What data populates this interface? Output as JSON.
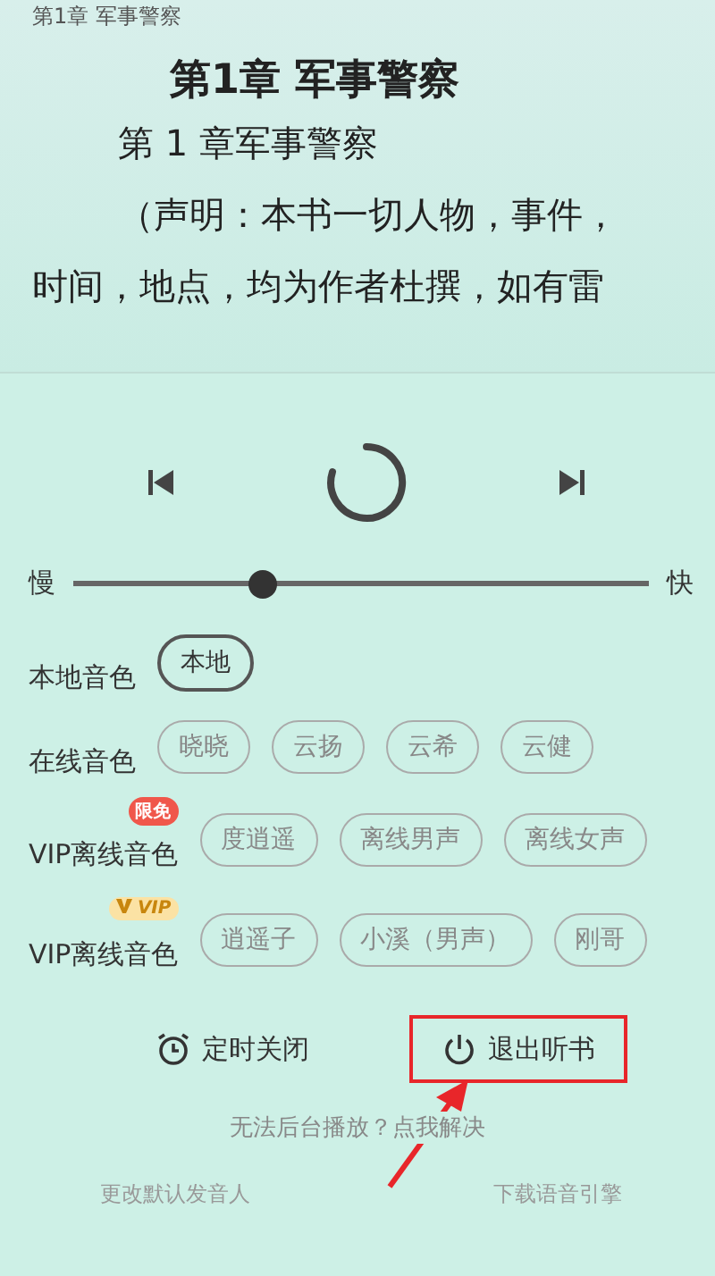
{
  "reader": {
    "header": "第1章 军事警察",
    "title": "第1章 军事警察",
    "paragraphs": [
      "第 1 章军事警察",
      "（声明：本书一切人物，事件，",
      "时间，地点，均为作者杜撰，如有雷"
    ]
  },
  "player": {
    "loading": true
  },
  "speed": {
    "slow_label": "慢",
    "fast_label": "快",
    "level": 0.33
  },
  "voice_rows": [
    {
      "label": "本地音色",
      "chips": [
        {
          "label": "本地",
          "selected": true
        }
      ]
    },
    {
      "label": "在线音色",
      "chips": [
        {
          "label": "晓晓",
          "selected": false
        },
        {
          "label": "云扬",
          "selected": false
        },
        {
          "label": "云希",
          "selected": false
        },
        {
          "label": "云健",
          "selected": false
        }
      ]
    },
    {
      "label": "VIP离线音色",
      "badge": {
        "kind": "free",
        "text": "限免"
      },
      "chips": [
        {
          "label": "度逍遥",
          "selected": false
        },
        {
          "label": "离线男声",
          "selected": false
        },
        {
          "label": "离线女声",
          "selected": false
        }
      ]
    },
    {
      "label": "VIP离线音色",
      "badge": {
        "kind": "vip",
        "text": "VIP"
      },
      "chips": [
        {
          "label": "逍遥子",
          "selected": false
        },
        {
          "label": "小溪（男声）",
          "selected": false
        },
        {
          "label": "刚哥",
          "selected": false
        }
      ]
    }
  ],
  "actions": [
    {
      "kind": "timer",
      "label": "定时关闭",
      "highlighted": false
    },
    {
      "kind": "power",
      "label": "退出听书",
      "highlighted": true
    }
  ],
  "hint": "无法后台播放？点我解决",
  "links": [
    "更改默认发音人",
    "下载语音引擎"
  ]
}
